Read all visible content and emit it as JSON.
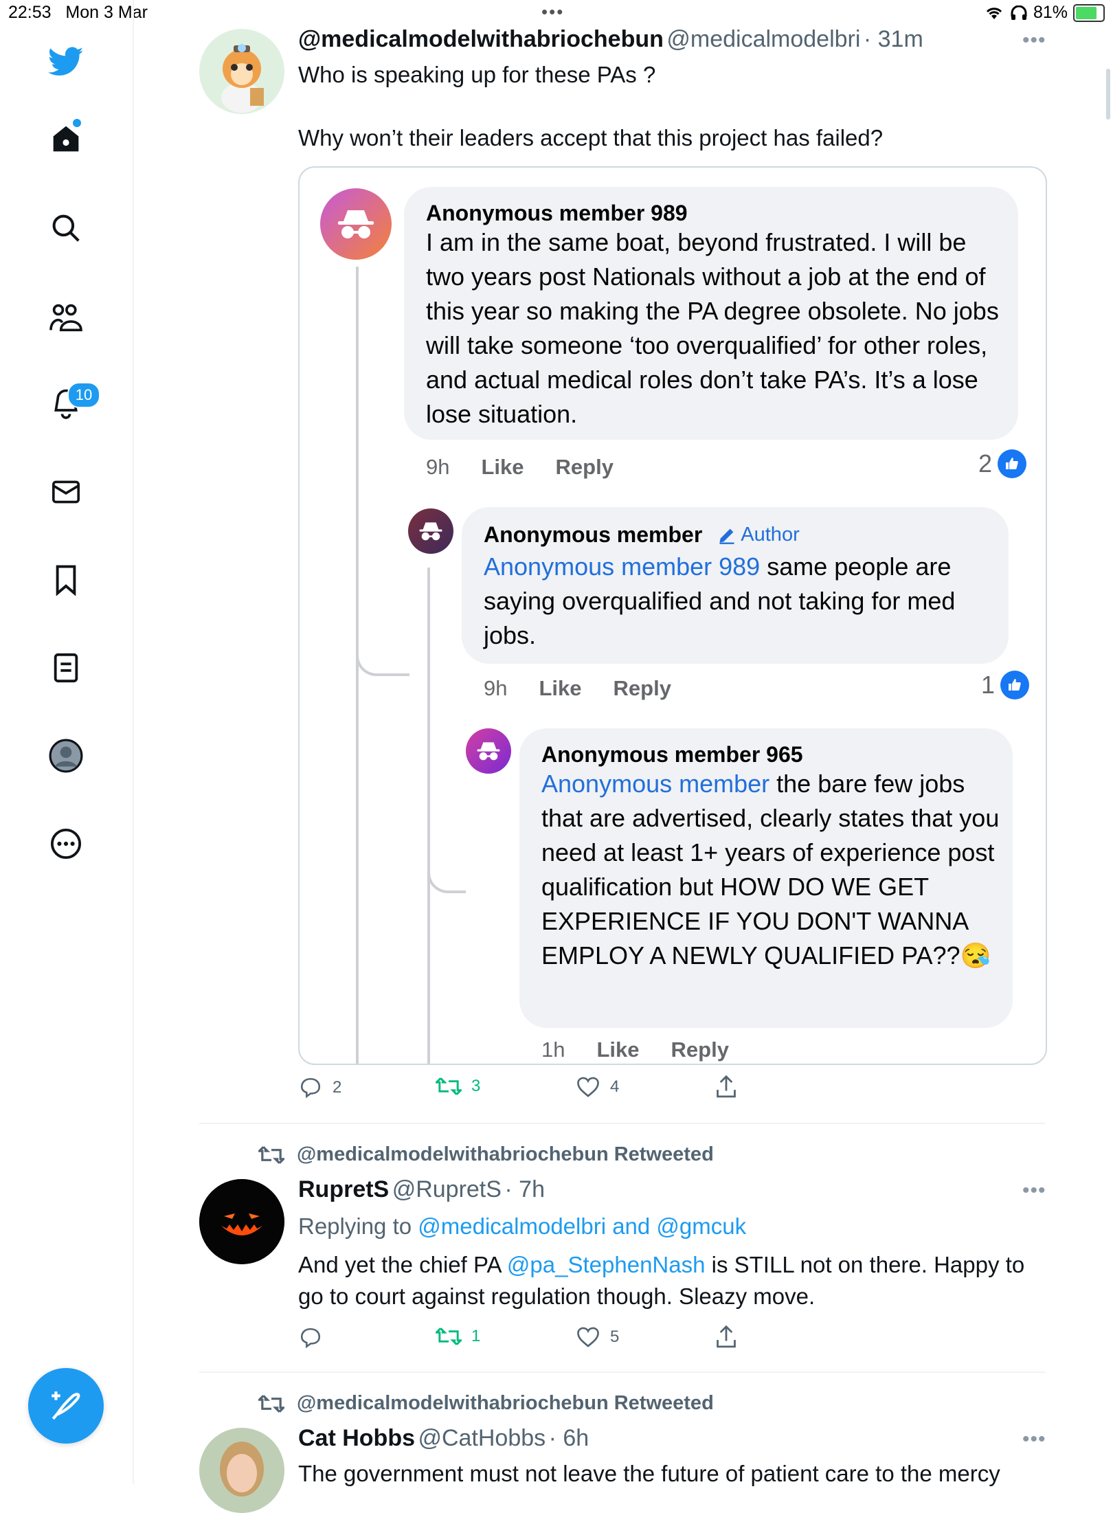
{
  "status_bar": {
    "time": "22:53",
    "date": "Mon 3 Mar",
    "dots": "•••",
    "battery": "81%"
  },
  "sidebar": {
    "notifications_badge": "10",
    "icons": [
      "twitter-logo-icon",
      "home-icon",
      "search-icon",
      "communities-icon",
      "notifications-icon",
      "messages-icon",
      "bookmarks-icon",
      "lists-icon",
      "profile-icon",
      "more-icon"
    ]
  },
  "tweet1": {
    "name": "@medicalmodelwithabriochebun",
    "handle": "@medicalmodelbri",
    "time": "· 31m",
    "text1": "Who is speaking up for these PAs ?",
    "text2": "Why won’t their leaders accept that this project has failed?",
    "replies": "2",
    "retweets": "3",
    "likes": "4"
  },
  "card": {
    "c1": {
      "name": "Anonymous member 989",
      "text": "I am in the same boat, beyond frustrated. I will be two years post Nationals without a job at the end of this year so making the PA degree obsolete. No jobs will take someone ‘too overqualified’ for other roles, and actual medical roles don’t take PA’s. It’s a lose lose situation.",
      "time": "9h",
      "like": "Like",
      "reply": "Reply",
      "count": "2"
    },
    "c2": {
      "name": "Anonymous member",
      "author_badge": "Author",
      "mention": "Anonymous member 989",
      "text": " same people are saying overqualified and not taking for med jobs.",
      "time": "9h",
      "like": "Like",
      "reply": "Reply",
      "count": "1"
    },
    "c3": {
      "name": "Anonymous member 965",
      "mention": "Anonymous member",
      "text": " the bare few jobs that are advertised, clearly states that you need at least 1+ years of experience post qualification but HOW DO WE GET EXPERIENCE IF YOU DON'T WANNA EMPLOY A NEWLY QUALIFIED PA??",
      "emoji": "😪",
      "time": "1h",
      "like": "Like",
      "reply": "Reply"
    }
  },
  "tweet2": {
    "retweeted_by": "@medicalmodelwithabriochebun Retweeted",
    "name": "RupretS",
    "handle": "@RupretS",
    "time": "· 7h",
    "replying_prefix": "Replying to ",
    "replying_to": "@medicalmodelbri and @gmcuk",
    "text_a": "And yet the chief PA ",
    "mention": "@pa_StephenNash",
    "text_b": " is STILL not on there. Happy to go to court against regulation though. Sleazy move.",
    "retweets": "1",
    "likes": "5"
  },
  "tweet3": {
    "retweeted_by": "@medicalmodelwithabriochebun Retweeted",
    "name": "Cat Hobbs",
    "handle": "@CatHobbs",
    "time": "· 6h",
    "text": "The government must not leave the future of patient care to the mercy"
  }
}
